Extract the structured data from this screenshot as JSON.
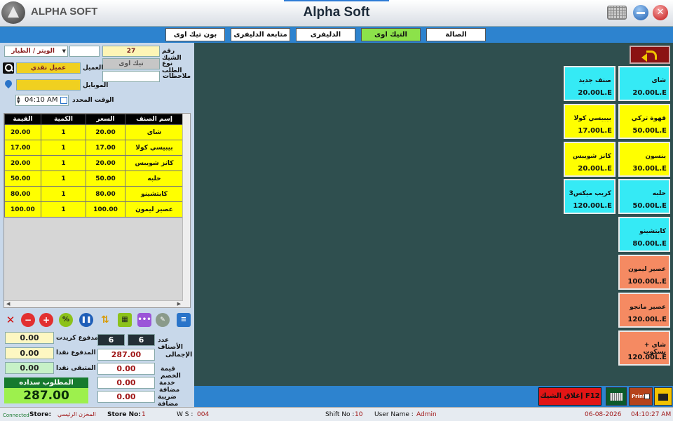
{
  "app": {
    "logo_text": "ALPHA SOFT",
    "title": "Alpha Soft"
  },
  "tabs": [
    {
      "label": "الصالة"
    },
    {
      "label": "التيك اوى",
      "active": true
    },
    {
      "label": "الدليفرى"
    },
    {
      "label": "متابعة الدليفرى"
    },
    {
      "label": "بون تيك اوى"
    }
  ],
  "order_form": {
    "check_no_label": "رقم الشيك",
    "check_no": "27",
    "waiter_value": "الويتر / الطيار",
    "order_type_label": "نوع الطلب",
    "order_type_value": "تيك اوى",
    "customer_label": "العميل",
    "customer_value": "عميل نقدي",
    "notes_label": "ملاحظات",
    "mobile_label": "الموبايل",
    "time_label": "الوقت المحدد",
    "time_value": "04:10 AM"
  },
  "items_table": {
    "headers": [
      "إسم الصنف",
      "السعر",
      "الكمية",
      "القيمة"
    ],
    "rows": [
      {
        "name": "شاى",
        "price": "20.00",
        "qty": "1",
        "value": "20.00"
      },
      {
        "name": "بيبيسي كولا",
        "price": "17.00",
        "qty": "1",
        "value": "17.00"
      },
      {
        "name": "كانز شويبس",
        "price": "20.00",
        "qty": "1",
        "value": "20.00"
      },
      {
        "name": "حلبه",
        "price": "50.00",
        "qty": "1",
        "value": "50.00"
      },
      {
        "name": "كابتشينو",
        "price": "80.00",
        "qty": "1",
        "value": "80.00"
      },
      {
        "name": "عصير ليمون",
        "price": "100.00",
        "qty": "1",
        "value": "100.00"
      }
    ]
  },
  "totals": {
    "paid_credit_label": "المدفوع كريدت",
    "paid_credit": "0.00",
    "paid_cash_label": "المدفوع نقدا",
    "paid_cash": "0.00",
    "remaining_cash_label": "المتبقى نقدا",
    "remaining_cash": "0.00",
    "due_label": "المطلوب سداده",
    "due_value": "287.00",
    "items_count_label": "عدد الأصناف",
    "items_count_a": "6",
    "items_count_b": "6",
    "total_label": "الإجمالى",
    "total_value": "287.00",
    "discount_label": "قيمة الخصم",
    "discount_value": "0.00",
    "service_label": "خدمة مضافة",
    "service_value": "0.00",
    "tax_label": "ضريبة مضافة",
    "tax_value": "0.00"
  },
  "products": [
    {
      "name": "شاى",
      "price": "20.00L.E",
      "color": "cyan"
    },
    {
      "name": "صنف جديد",
      "price": "20.00L.E",
      "color": "cyan"
    },
    {
      "name": "قهوة تركي",
      "price": "50.00L.E",
      "color": "yellow"
    },
    {
      "name": "بيبيسي كولا",
      "price": "17.00L.E",
      "color": "yellow"
    },
    {
      "name": "ينسون",
      "price": "30.00L.E",
      "color": "yellow"
    },
    {
      "name": "كانز شويبس",
      "price": "20.00L.E",
      "color": "yellow"
    },
    {
      "name": "حلبه",
      "price": "50.00L.E",
      "color": "cyan"
    },
    {
      "name": "3كريب ميكس",
      "price": "120.00L.E",
      "color": "cyan"
    },
    {
      "name": "كابتشينو",
      "price": "80.00L.E",
      "color": "cyan"
    },
    {
      "name": "عصير ليمون",
      "price": "100.00L.E",
      "color": "salmon"
    },
    {
      "name": "عصير مانجو",
      "price": "120.00L.E",
      "color": "salmon"
    },
    {
      "name": "شاي + بسكوت",
      "price": "120.00L.E",
      "color": "salmon"
    }
  ],
  "actions": {
    "close_check": "إغلاق الشيك F12",
    "print": "Print"
  },
  "status_bar": {
    "connection": "Connected",
    "store_label": "Store:",
    "store_value": "المخزن الرئيسي",
    "store_no_label": "Store No:",
    "store_no": "1",
    "ws_label": "W S :",
    "ws_value": "004",
    "shift_label": "Shift No :",
    "shift_value": "10",
    "user_label": "User Name :",
    "user_value": "Admin",
    "date": "06-08-2026",
    "time": "04:10:27 AM"
  },
  "colors": {
    "tabbar": "#2d83cf",
    "workspace": "#2f4f4f",
    "active_tab": "#8ce24a",
    "table_row": "#ffff00"
  }
}
